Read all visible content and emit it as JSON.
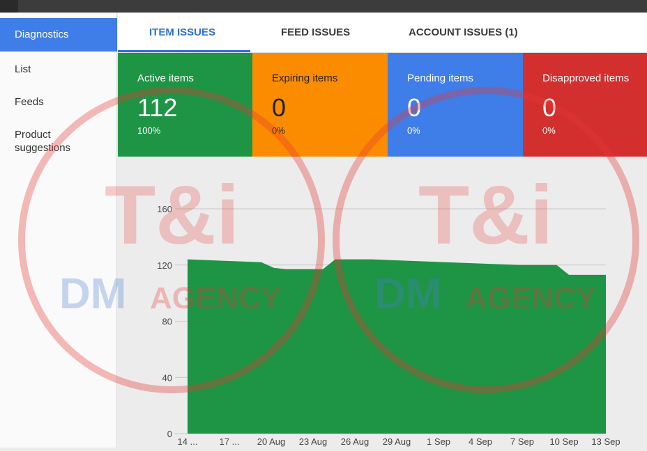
{
  "sidebar": {
    "items": [
      {
        "label": "Diagnostics",
        "active": true
      },
      {
        "label": "List",
        "active": false
      },
      {
        "label": "Feeds",
        "active": false
      },
      {
        "label": "Product suggestions",
        "active": false
      }
    ]
  },
  "tabs": [
    {
      "label": "ITEM ISSUES",
      "active": true
    },
    {
      "label": "FEED ISSUES",
      "active": false
    },
    {
      "label": "ACCOUNT ISSUES (1)",
      "active": false
    }
  ],
  "cards": [
    {
      "label": "Active items",
      "value": "112",
      "percent": "100%",
      "color": "#1e9445"
    },
    {
      "label": "Expiring items",
      "value": "0",
      "percent": "0%",
      "color": "#fb8c00"
    },
    {
      "label": "Pending items",
      "value": "0",
      "percent": "0%",
      "color": "#3f7de8"
    },
    {
      "label": "Disapproved items",
      "value": "0",
      "percent": "0%",
      "color": "#d32f2f"
    }
  ],
  "watermark": {
    "brand_line": "DM",
    "agency": "AGENCY",
    "monogram": "T&i"
  },
  "chart_data": {
    "type": "area",
    "x": [
      "14 ...",
      "17 ...",
      "20 Aug",
      "23 Aug",
      "26 Aug",
      "29 Aug",
      "1 Sep",
      "4 Sep",
      "7 Sep",
      "10 Sep",
      "13 Sep"
    ],
    "series": [
      {
        "color": "#1e9445",
        "points": [
          [
            0,
            124
          ],
          [
            3,
            123
          ],
          [
            6,
            122
          ],
          [
            7,
            118
          ],
          [
            8,
            117
          ],
          [
            10,
            117
          ],
          [
            11,
            117
          ],
          [
            12,
            124
          ],
          [
            15,
            124
          ],
          [
            18,
            123
          ],
          [
            21,
            122
          ],
          [
            24,
            121
          ],
          [
            27,
            120
          ],
          [
            30,
            120
          ],
          [
            31,
            113
          ],
          [
            33,
            113
          ],
          [
            34,
            113
          ]
        ]
      }
    ],
    "yticks": [
      0,
      40,
      80,
      120,
      160
    ],
    "ylim": [
      0,
      160
    ],
    "grid": true,
    "xlabel": "",
    "ylabel": ""
  }
}
